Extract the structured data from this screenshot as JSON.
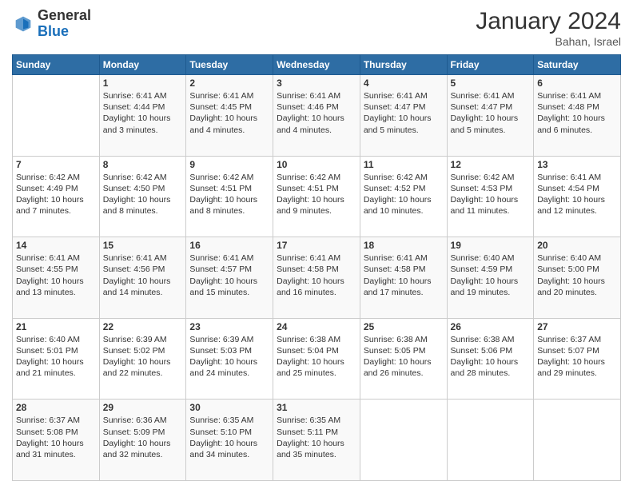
{
  "header": {
    "logo_general": "General",
    "logo_blue": "Blue",
    "month_title": "January 2024",
    "location": "Bahan, Israel"
  },
  "weekdays": [
    "Sunday",
    "Monday",
    "Tuesday",
    "Wednesday",
    "Thursday",
    "Friday",
    "Saturday"
  ],
  "weeks": [
    [
      null,
      {
        "day": "1",
        "sunrise": "6:41 AM",
        "sunset": "4:44 PM",
        "daylight": "10 hours and 3 minutes."
      },
      {
        "day": "2",
        "sunrise": "6:41 AM",
        "sunset": "4:45 PM",
        "daylight": "10 hours and 4 minutes."
      },
      {
        "day": "3",
        "sunrise": "6:41 AM",
        "sunset": "4:46 PM",
        "daylight": "10 hours and 4 minutes."
      },
      {
        "day": "4",
        "sunrise": "6:41 AM",
        "sunset": "4:47 PM",
        "daylight": "10 hours and 5 minutes."
      },
      {
        "day": "5",
        "sunrise": "6:41 AM",
        "sunset": "4:47 PM",
        "daylight": "10 hours and 5 minutes."
      },
      {
        "day": "6",
        "sunrise": "6:41 AM",
        "sunset": "4:48 PM",
        "daylight": "10 hours and 6 minutes."
      }
    ],
    [
      {
        "day": "7",
        "sunrise": "6:42 AM",
        "sunset": "4:49 PM",
        "daylight": "10 hours and 7 minutes."
      },
      {
        "day": "8",
        "sunrise": "6:42 AM",
        "sunset": "4:50 PM",
        "daylight": "10 hours and 8 minutes."
      },
      {
        "day": "9",
        "sunrise": "6:42 AM",
        "sunset": "4:51 PM",
        "daylight": "10 hours and 8 minutes."
      },
      {
        "day": "10",
        "sunrise": "6:42 AM",
        "sunset": "4:51 PM",
        "daylight": "10 hours and 9 minutes."
      },
      {
        "day": "11",
        "sunrise": "6:42 AM",
        "sunset": "4:52 PM",
        "daylight": "10 hours and 10 minutes."
      },
      {
        "day": "12",
        "sunrise": "6:42 AM",
        "sunset": "4:53 PM",
        "daylight": "10 hours and 11 minutes."
      },
      {
        "day": "13",
        "sunrise": "6:41 AM",
        "sunset": "4:54 PM",
        "daylight": "10 hours and 12 minutes."
      }
    ],
    [
      {
        "day": "14",
        "sunrise": "6:41 AM",
        "sunset": "4:55 PM",
        "daylight": "10 hours and 13 minutes."
      },
      {
        "day": "15",
        "sunrise": "6:41 AM",
        "sunset": "4:56 PM",
        "daylight": "10 hours and 14 minutes."
      },
      {
        "day": "16",
        "sunrise": "6:41 AM",
        "sunset": "4:57 PM",
        "daylight": "10 hours and 15 minutes."
      },
      {
        "day": "17",
        "sunrise": "6:41 AM",
        "sunset": "4:58 PM",
        "daylight": "10 hours and 16 minutes."
      },
      {
        "day": "18",
        "sunrise": "6:41 AM",
        "sunset": "4:58 PM",
        "daylight": "10 hours and 17 minutes."
      },
      {
        "day": "19",
        "sunrise": "6:40 AM",
        "sunset": "4:59 PM",
        "daylight": "10 hours and 19 minutes."
      },
      {
        "day": "20",
        "sunrise": "6:40 AM",
        "sunset": "5:00 PM",
        "daylight": "10 hours and 20 minutes."
      }
    ],
    [
      {
        "day": "21",
        "sunrise": "6:40 AM",
        "sunset": "5:01 PM",
        "daylight": "10 hours and 21 minutes."
      },
      {
        "day": "22",
        "sunrise": "6:39 AM",
        "sunset": "5:02 PM",
        "daylight": "10 hours and 22 minutes."
      },
      {
        "day": "23",
        "sunrise": "6:39 AM",
        "sunset": "5:03 PM",
        "daylight": "10 hours and 24 minutes."
      },
      {
        "day": "24",
        "sunrise": "6:38 AM",
        "sunset": "5:04 PM",
        "daylight": "10 hours and 25 minutes."
      },
      {
        "day": "25",
        "sunrise": "6:38 AM",
        "sunset": "5:05 PM",
        "daylight": "10 hours and 26 minutes."
      },
      {
        "day": "26",
        "sunrise": "6:38 AM",
        "sunset": "5:06 PM",
        "daylight": "10 hours and 28 minutes."
      },
      {
        "day": "27",
        "sunrise": "6:37 AM",
        "sunset": "5:07 PM",
        "daylight": "10 hours and 29 minutes."
      }
    ],
    [
      {
        "day": "28",
        "sunrise": "6:37 AM",
        "sunset": "5:08 PM",
        "daylight": "10 hours and 31 minutes."
      },
      {
        "day": "29",
        "sunrise": "6:36 AM",
        "sunset": "5:09 PM",
        "daylight": "10 hours and 32 minutes."
      },
      {
        "day": "30",
        "sunrise": "6:35 AM",
        "sunset": "5:10 PM",
        "daylight": "10 hours and 34 minutes."
      },
      {
        "day": "31",
        "sunrise": "6:35 AM",
        "sunset": "5:11 PM",
        "daylight": "10 hours and 35 minutes."
      },
      null,
      null,
      null
    ]
  ]
}
